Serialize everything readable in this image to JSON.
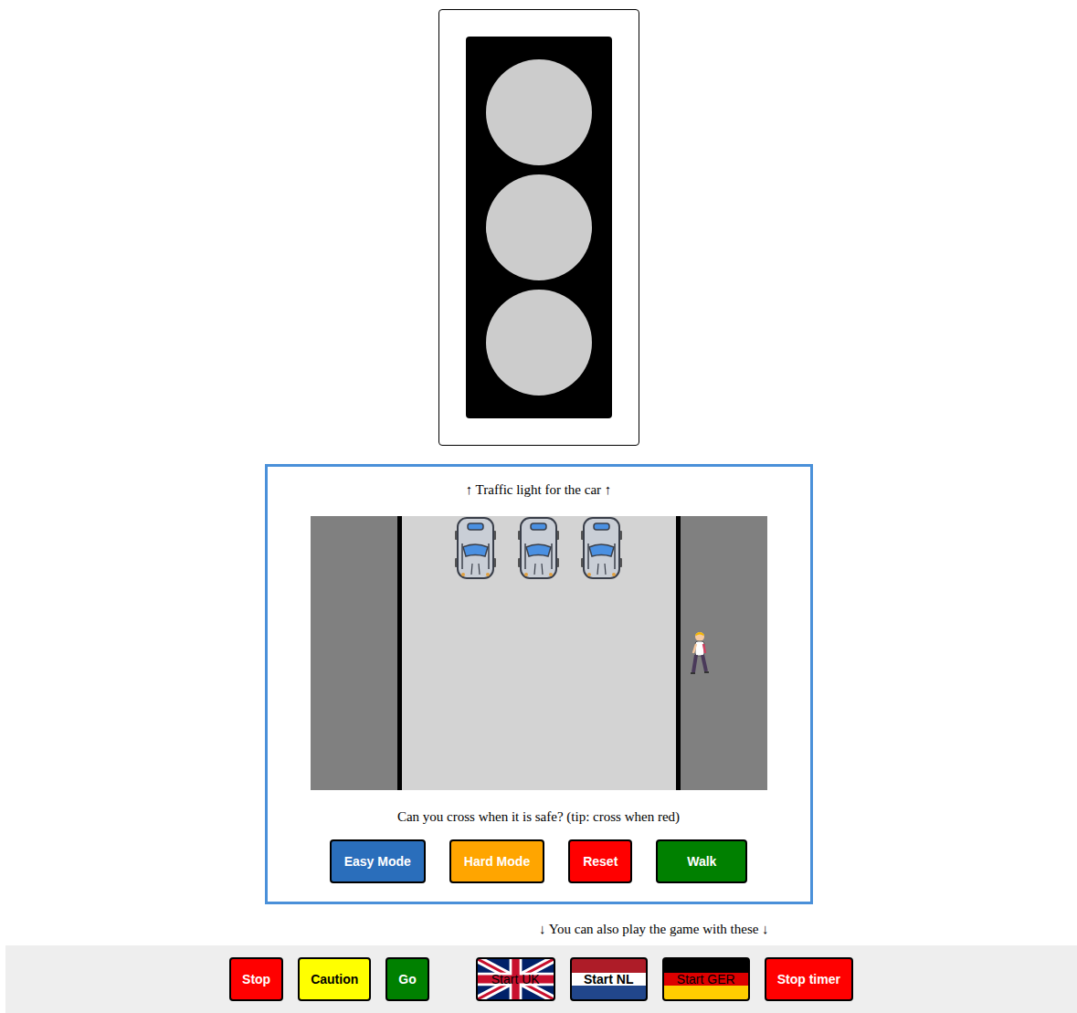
{
  "traffic_light": {
    "lights": [
      {
        "on": false
      },
      {
        "on": false
      },
      {
        "on": false
      }
    ]
  },
  "game": {
    "caption_top": "↑ Traffic light for the car ↑",
    "cars": [
      {
        "moving": false
      },
      {
        "moving": false
      },
      {
        "moving": false
      }
    ],
    "pedestrian": {
      "crossing": false
    },
    "question": "Can you cross when it is safe? (tip: cross when red)",
    "buttons": [
      "Easy Mode",
      "Hard Mode",
      "Reset",
      "Walk"
    ]
  },
  "hint": "↓ You can also play the game with these ↓",
  "controls": [
    {
      "label": "Stop",
      "kind": "red"
    },
    {
      "label": "Caution",
      "kind": "yellow"
    },
    {
      "label": "Go",
      "kind": "green"
    },
    {
      "label": "Start UK",
      "kind": "uk"
    },
    {
      "label": "Start NL",
      "kind": "nl"
    },
    {
      "label": "Start GER",
      "kind": "ger"
    },
    {
      "label": "Stop timer",
      "kind": "red"
    }
  ]
}
